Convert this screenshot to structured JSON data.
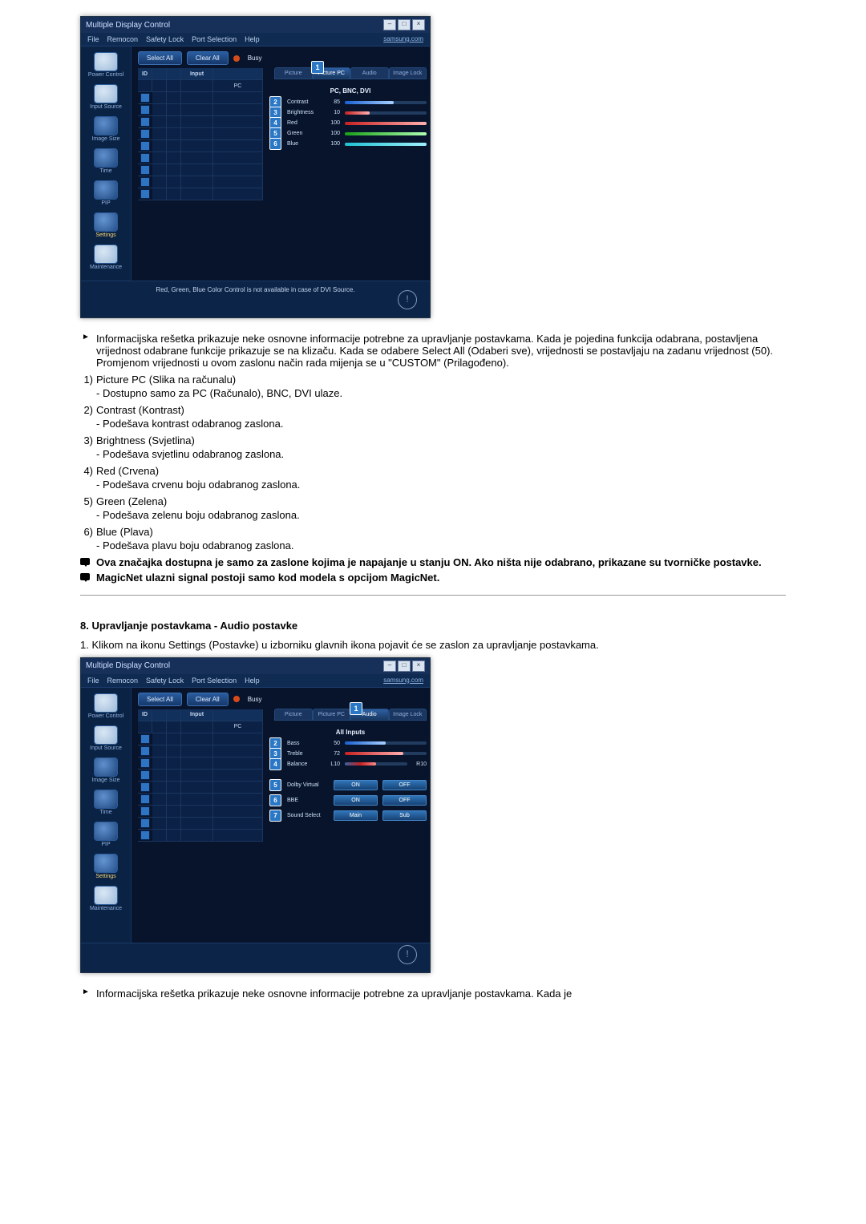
{
  "app": {
    "title": "Multiple Display Control",
    "win_min": "–",
    "win_max": "□",
    "win_close": "×",
    "menu": [
      "File",
      "Remocon",
      "Safety Lock",
      "Port Selection",
      "Help"
    ],
    "menu_right": "samsung.com",
    "tool_select_all": "Select All",
    "tool_clear_all": "Clear All",
    "tool_busy": "Busy",
    "sidebar": [
      "Power Control",
      "Input Source",
      "Image Size",
      "Time",
      "PIP",
      "Settings",
      "Maintenance"
    ],
    "grid_headers": [
      "ID",
      "",
      "",
      "Input",
      "PC"
    ]
  },
  "screen1": {
    "tabs": [
      "Picture",
      "Picture PC",
      "Audio",
      "Image Lock"
    ],
    "active_tab_index": 1,
    "tab_badge": "1",
    "panel_title": "PC, BNC, DVI",
    "rows": [
      {
        "n": "2",
        "label": "Contrast",
        "val": "85",
        "fill": 60,
        "color": "blue"
      },
      {
        "n": "3",
        "label": "Brightness",
        "val": "10",
        "fill": 30,
        "color": "redshort"
      },
      {
        "n": "4",
        "label": "Red",
        "val": "100",
        "fill": 100,
        "color": "red"
      },
      {
        "n": "5",
        "label": "Green",
        "val": "100",
        "fill": 100,
        "color": "green"
      },
      {
        "n": "6",
        "label": "Blue",
        "val": "100",
        "fill": 100,
        "color": "cyan"
      }
    ],
    "footer": "Red, Green, Blue Color Control is not available in case of DVI Source."
  },
  "text1": {
    "intro": "Informacijska rešetka prikazuje neke osnovne informacije potrebne za upravljanje postavkama. Kada je pojedina funkcija odabrana, postavljena vrijednost odabrane funkcije prikazuje se na klizaču. Kada se odabere Select All (Odaberi sve), vrijednosti se postavljaju na zadanu vrijednost (50). Promjenom vrijednosti u ovom zaslonu način rada mijenja se u \"CUSTOM\" (Prilagođeno).",
    "items": [
      {
        "n": "1)",
        "h": "Picture PC (Slika na računalu)",
        "s": "Dostupno samo za PC (Računalo), BNC, DVI ulaze."
      },
      {
        "n": "2)",
        "h": "Contrast (Kontrast)",
        "s": "Podešava kontrast odabranog zaslona."
      },
      {
        "n": "3)",
        "h": "Brightness (Svjetlina)",
        "s": "Podešava svjetlinu odabranog zaslona."
      },
      {
        "n": "4)",
        "h": "Red (Crvena)",
        "s": "Podešava crvenu boju odabranog zaslona."
      },
      {
        "n": "5)",
        "h": "Green (Zelena)",
        "s": "Podešava zelenu boju odabranog zaslona."
      },
      {
        "n": "6)",
        "h": "Blue (Plava)",
        "s": "Podešava plavu boju odabranog zaslona."
      }
    ],
    "note1": "Ova značajka dostupna je samo za zaslone kojima je napajanje u stanju ON. Ako ništa nije odabrano, prikazane su tvorničke postavke.",
    "note2": "MagicNet ulazni signal postoji samo kod modela s opcijom MagicNet."
  },
  "section2_heading": "8. Upravljanje postavkama - Audio postavke",
  "text2_intro_item": "1.  Klikom na ikonu Settings (Postavke) u izborniku glavnih ikona pojavit će se zaslon za upravljanje postavkama.",
  "screen2": {
    "tabs": [
      "Picture",
      "Picture PC",
      "Audio",
      "Image Lock"
    ],
    "active_tab_index": 2,
    "tab_badge": "1",
    "panel_title": "All Inputs",
    "sliders": [
      {
        "n": "2",
        "label": "Bass",
        "val": "50",
        "fill": 50,
        "color": "blue"
      },
      {
        "n": "3",
        "label": "Treble",
        "val": "72",
        "fill": 72,
        "color": "red"
      },
      {
        "n": "4",
        "label": "Balance",
        "val": "L10",
        "val2": "R10",
        "fill": 50,
        "color": "bal"
      }
    ],
    "toggles": [
      {
        "n": "5",
        "label": "Dolby Virtual",
        "a": "ON",
        "b": "OFF"
      },
      {
        "n": "6",
        "label": "BBE",
        "a": "ON",
        "b": "OFF"
      },
      {
        "n": "7",
        "label": "Sound Select",
        "a": "Main",
        "b": "Sub"
      }
    ]
  },
  "text3_intro": "Informacijska rešetka prikazuje neke osnovne informacije potrebne za upravljanje postavkama. Kada je"
}
